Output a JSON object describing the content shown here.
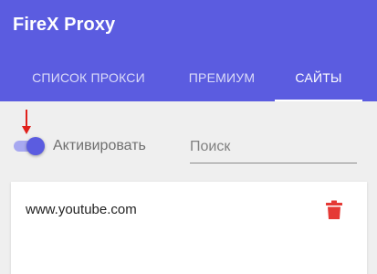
{
  "app": {
    "title": "FireX Proxy"
  },
  "tabs": [
    {
      "label": "СПИСОК ПРОКСИ",
      "active": false
    },
    {
      "label": "ПРЕМИУМ",
      "active": false
    },
    {
      "label": "САЙТЫ",
      "active": true
    }
  ],
  "controls": {
    "toggle": {
      "label": "Активировать",
      "on": true
    },
    "search": {
      "placeholder": "Поиск",
      "value": ""
    }
  },
  "sites": [
    {
      "domain": "www.youtube.com",
      "action_icon": "trash-icon"
    }
  ],
  "colors": {
    "primary": "#5b5ce0",
    "toggle_track": "#a7a8f0",
    "delete": "#e53935",
    "annotation_arrow": "#e0201b",
    "background": "#efefef"
  }
}
